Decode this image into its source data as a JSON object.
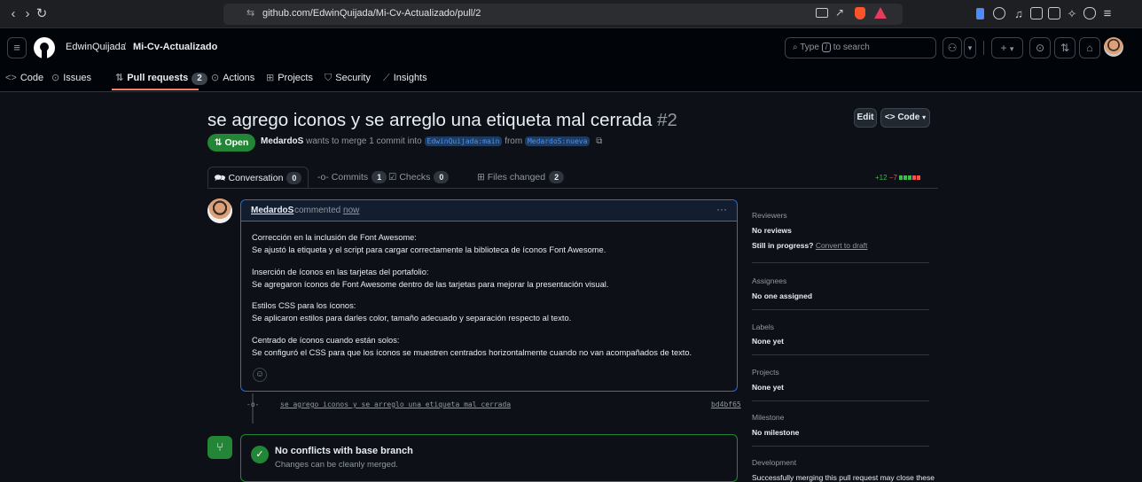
{
  "browser": {
    "url": "github.com/EdwinQuijada/Mi-Cv-Actualizado/pull/2"
  },
  "header": {
    "owner": "EdwinQuijada",
    "separator": "/",
    "repo": "Mi-Cv-Actualizado",
    "search_placeholder": "Type",
    "search_key": "/",
    "search_suffix": "to search",
    "plus_label": "+",
    "dropdown_caret": "▾"
  },
  "repo_tabs": [
    {
      "label": "Code"
    },
    {
      "label": "Issues"
    },
    {
      "label": "Pull requests",
      "count": "2"
    },
    {
      "label": "Actions"
    },
    {
      "label": "Projects"
    },
    {
      "label": "Security"
    },
    {
      "label": "Insights"
    }
  ],
  "pr": {
    "title": "se agrego iconos y se arreglo una etiqueta mal cerrada",
    "number": "#2",
    "edit_label": "Edit",
    "code_label": "Code",
    "status": "Open",
    "author": "MedardoS",
    "merge_text_1": "wants to merge 1 commit into",
    "base_branch": "EdwinQuijada:main",
    "merge_text_2": "from",
    "head_branch": "MedardoS:nueva",
    "tabs": [
      {
        "label": "Conversation",
        "count": "0"
      },
      {
        "label": "Commits",
        "count": "1"
      },
      {
        "label": "Checks",
        "count": "0"
      },
      {
        "label": "Files changed",
        "count": "2"
      }
    ],
    "additions": "+12",
    "deletions": "−7"
  },
  "comment": {
    "author": "MedardoS",
    "action": "commented",
    "time": "now",
    "paragraphs": [
      {
        "line1": "Corrección en la inclusión de Font Awesome:",
        "line2": "Se ajustó la etiqueta y el script para cargar correctamente la biblioteca de íconos Font Awesome."
      },
      {
        "line1": "Inserción de íconos en las tarjetas del portafolio:",
        "line2": "Se agregaron íconos de Font Awesome dentro de las tarjetas para mejorar la presentación visual."
      },
      {
        "line1": "Estilos CSS para los íconos:",
        "line2": "Se aplicaron estilos para darles color, tamaño adecuado y separación respecto al texto."
      },
      {
        "line1": "Centrado de íconos cuando están solos:",
        "line2": "Se configuró el CSS para que los íconos se muestren centrados horizontalmente cuando no van acompañados de texto."
      }
    ]
  },
  "commit": {
    "message": "se agrego iconos y se arreglo una etiqueta mal cerrada",
    "sha": "bd4bf65"
  },
  "merge": {
    "title": "No conflicts with base branch",
    "subtitle": "Changes can be cleanly merged."
  },
  "sidebar": {
    "reviewers_label": "Reviewers",
    "reviewers_value": "No reviews",
    "in_progress": "Still in progress?",
    "convert_draft": "Convert to draft",
    "assignees_label": "Assignees",
    "assignees_value": "No one assigned",
    "labels_label": "Labels",
    "labels_value": "None yet",
    "projects_label": "Projects",
    "projects_value": "None yet",
    "milestone_label": "Milestone",
    "milestone_value": "No milestone",
    "development_label": "Development",
    "development_value": "Successfully merging this pull request may close these"
  },
  "colors": {
    "open_green": "#238636",
    "accent_blue": "#1f6feb",
    "add_green": "#3fb950",
    "del_red": "#f85149"
  }
}
